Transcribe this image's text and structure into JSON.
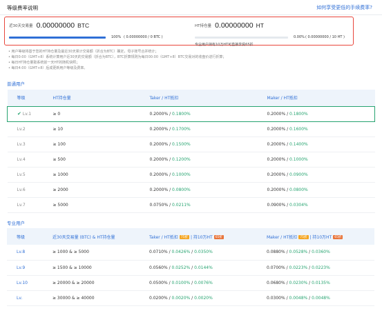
{
  "topbar": {
    "title": "等级费率说明",
    "help_link": "如何享受更低的手续费率?"
  },
  "stats": {
    "volume": {
      "label": "近30天交易量",
      "value": "0.00000000",
      "unit": "BTC",
      "progress_percent": 100,
      "progress_text": "100%",
      "progress_detail": "( 0.00000000 / 0 BTC )"
    },
    "holding": {
      "label": "HT持仓量",
      "value": "0.00000000",
      "unit": "HT",
      "progress_percent": 0,
      "progress_text": "0.00%",
      "progress_detail": "( 0.00000000 / 10 HT )",
      "note": "专业用户持有10万HT可直接享受65折"
    }
  },
  "notes": [
    "• 用户等级将基于您的HT持仓量及最近30天累计交易额（折合为BTC）确定，母子账号合并统计；",
    "• 每日0:00（GMT+8）系统计算用户近30天的交易额（折合为BTC），BTC折算规则为每日00:00（GMT+8）BTC交易对的收盘价进行折算；",
    "• 每日HT持仓量取系统前一天HT的随机快照；",
    "• 每日4:00（GMT+8）后成更新用户等级及费率。"
  ],
  "regular": {
    "section_label": "普通用户",
    "headers": [
      "等级",
      "HT持仓量",
      "Taker / HT抵扣",
      "Maker / HT抵扣"
    ],
    "rows": [
      {
        "level": "Lv.1",
        "holding": "≥ 0",
        "taker": "0.2000%",
        "taker_ht": "0.1800%",
        "maker": "0.2000%",
        "maker_ht": "0.1800%",
        "active": true
      },
      {
        "level": "Lv.2",
        "holding": "≥ 10",
        "taker": "0.2000%",
        "taker_ht": "0.1700%",
        "maker": "0.2000%",
        "maker_ht": "0.1600%"
      },
      {
        "level": "Lv.3",
        "holding": "≥ 100",
        "taker": "0.2000%",
        "taker_ht": "0.1500%",
        "maker": "0.2000%",
        "maker_ht": "0.1400%"
      },
      {
        "level": "Lv.4",
        "holding": "≥ 500",
        "taker": "0.2000%",
        "taker_ht": "0.1200%",
        "maker": "0.2000%",
        "maker_ht": "0.1000%"
      },
      {
        "level": "Lv.5",
        "holding": "≥ 1000",
        "taker": "0.2000%",
        "taker_ht": "0.1000%",
        "maker": "0.2000%",
        "maker_ht": "0.0900%"
      },
      {
        "level": "Lv.6",
        "holding": "≥ 2000",
        "taker": "0.2000%",
        "taker_ht": "0.0800%",
        "maker": "0.2000%",
        "maker_ht": "0.0800%"
      },
      {
        "level": "Lv.7",
        "holding": "≥ 5000",
        "taker": "0.0750%",
        "taker_ht": "0.0211%",
        "maker": "0.0900%",
        "maker_ht": "0.0304%"
      }
    ]
  },
  "pro": {
    "section_label": "专业用户",
    "headers": {
      "level": "等级",
      "volume": "近30天交易量 (BTC) & HT持仓量",
      "taker": "Taker / HT抵扣",
      "taker_badge1": "75折",
      "taker_mid": "| 持10万HT",
      "taker_badge2": "65折",
      "maker": "Maker / HT抵扣",
      "maker_badge1": "75折",
      "maker_mid": "| 持10万HT",
      "maker_badge2": "65折"
    },
    "rows": [
      {
        "level": "Lv.8",
        "volume": "≥ 1000 & ≥ 5000",
        "taker": "0.0710%",
        "taker_ht1": "0.0426%",
        "taker_ht2": "0.0350%",
        "maker": "0.0880%",
        "maker_ht1": "0.0528%",
        "maker_ht2": "0.0360%"
      },
      {
        "level": "Lv.9",
        "volume": "≥ 1500 & ≥ 10000",
        "taker": "0.0560%",
        "taker_ht1": "0.0252%",
        "taker_ht2": "0.0144%",
        "maker": "0.0700%",
        "maker_ht1": "0.0223%",
        "maker_ht2": "0.0223%"
      },
      {
        "level": "Lv.10",
        "volume": "≥ 20000 & ≥ 20000",
        "taker": "0.0500%",
        "taker_ht1": "0.0100%",
        "taker_ht2": "0.0076%",
        "maker": "0.0680%",
        "maker_ht1": "0.0230%",
        "maker_ht2": "0.0135%"
      },
      {
        "level": "Lv.",
        "volume": "≥ 30000 & ≥ 40000",
        "taker": "0.0200%",
        "taker_ht1": "0.0020%",
        "taker_ht2": "0.0020%",
        "maker": "0.0300%",
        "maker_ht1": "0.0048%",
        "maker_ht2": "0.0048%"
      }
    ]
  },
  "colors": {
    "accent": "#2f6fd6",
    "green": "#25a36f",
    "highlight_border": "#e8443a",
    "badge": "#f5a623"
  }
}
